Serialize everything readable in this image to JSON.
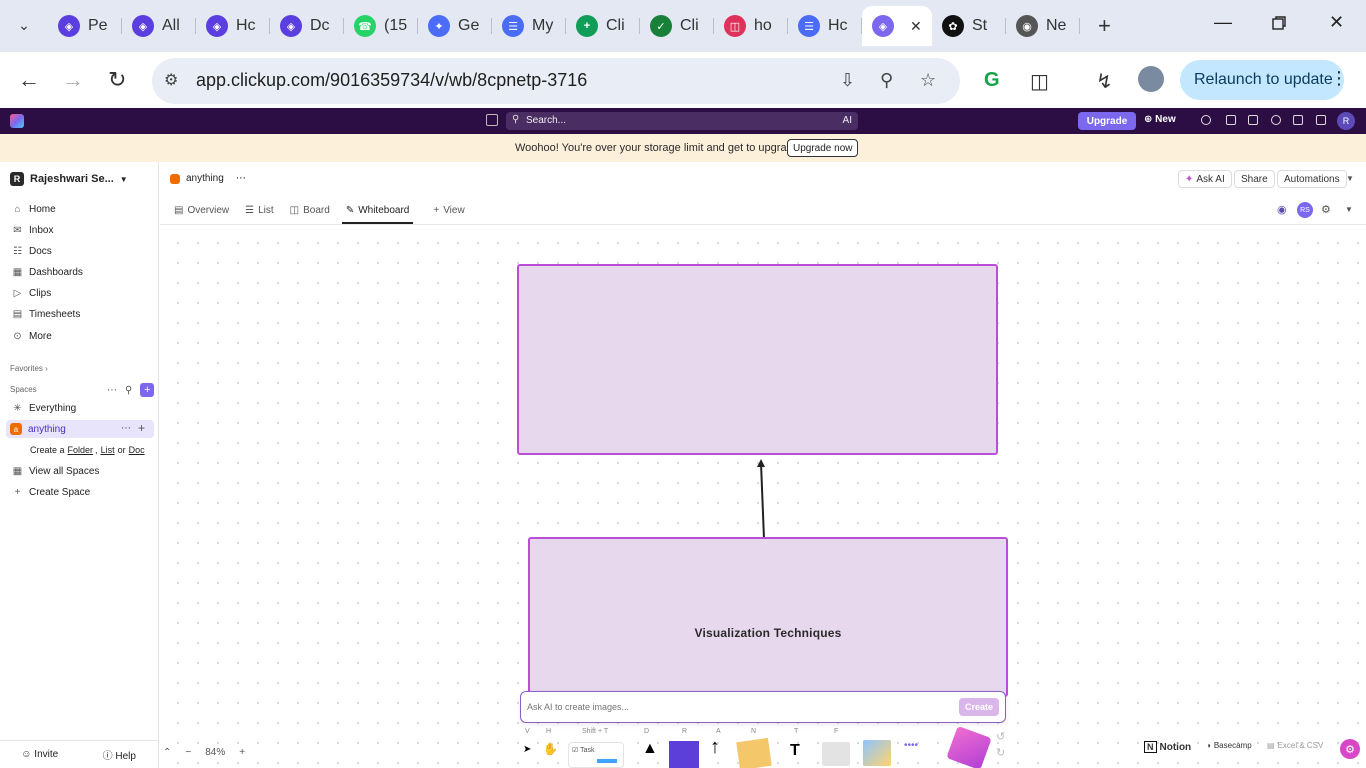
{
  "browser": {
    "tabs": [
      {
        "label": "Pe",
        "icon": "clickup-icon",
        "color": "#5a3ee0"
      },
      {
        "label": "All",
        "icon": "clickup-icon",
        "color": "#5a3ee0"
      },
      {
        "label": "Hc",
        "icon": "clickup-icon",
        "color": "#5a3ee0"
      },
      {
        "label": "Dc",
        "icon": "clickup-icon",
        "color": "#5a3ee0"
      },
      {
        "label": "(15",
        "icon": "whatsapp-icon",
        "color": "#25d366"
      },
      {
        "label": "Ge",
        "icon": "gemini-icon",
        "color": "#4a6cf7"
      },
      {
        "label": "My",
        "icon": "docs-icon",
        "color": "#4a6cf7"
      },
      {
        "label": "Cli",
        "icon": "sheets-plus-icon",
        "color": "#0f9d58"
      },
      {
        "label": "Cli",
        "icon": "check-icon",
        "color": "#188038"
      },
      {
        "label": "ho",
        "icon": "podcast-icon",
        "color": "#e0315a"
      },
      {
        "label": "Hc",
        "icon": "docs-icon",
        "color": "#4a6cf7"
      },
      {
        "label": "",
        "icon": "clickup-icon",
        "color": "#7b68ee",
        "active": true
      },
      {
        "label": "St",
        "icon": "openai-icon",
        "color": "#111111"
      },
      {
        "label": "Ne",
        "icon": "chrome-icon",
        "color": "#555555"
      }
    ],
    "url": "app.clickup.com/9016359734/v/wb/8cpnetp-3716",
    "relaunch_label": "Relaunch to update"
  },
  "topbar": {
    "search_placeholder": "Search...",
    "ai_label": "AI",
    "upgrade_label": "Upgrade",
    "new_label": "New",
    "avatar_initial": "R"
  },
  "banner": {
    "text": "Woohoo! You're over your storage limit and get to upgrade :)",
    "button": "Upgrade now"
  },
  "sidebar": {
    "workspace": "Rajeshwari Se...",
    "workspace_initial": "R",
    "nav": [
      "Home",
      "Inbox",
      "Docs",
      "Dashboards",
      "Clips",
      "Timesheets",
      "More"
    ],
    "favorites_label": "Favorites",
    "spaces_label": "Spaces",
    "everything_label": "Everything",
    "space_name": "anything",
    "space_initial": "a",
    "create_prefix": "Create a",
    "create_folder": "Folder",
    "create_list": "List",
    "create_or": "or",
    "create_doc": "Doc",
    "view_all_spaces": "View all Spaces",
    "create_space": "Create Space",
    "invite_label": "Invite",
    "help_label": "Help"
  },
  "header": {
    "breadcrumb": "anything",
    "ask_ai": "Ask AI",
    "share": "Share",
    "automations": "Automations",
    "views": [
      "Overview",
      "List",
      "Board",
      "Whiteboard"
    ],
    "add_view": "View",
    "active_view": "Whiteboard",
    "user_initials": "RS"
  },
  "whiteboard": {
    "box_bottom_label": "Visualization Techniques",
    "box_fill": "#e8d8ee",
    "box_stroke": "#b94fd6",
    "ai_placeholder": "Ask AI to create images...",
    "ai_create_label": "Create",
    "toolbar_keys": [
      "V",
      "H",
      "Shift + T",
      "D",
      "R",
      "A",
      "N",
      "T",
      "F"
    ],
    "task_label": "Task",
    "zoom": "84%"
  },
  "integrations": {
    "notion": "Notion",
    "basecamp": "Basecamp",
    "excel": "Excel & CSV"
  }
}
